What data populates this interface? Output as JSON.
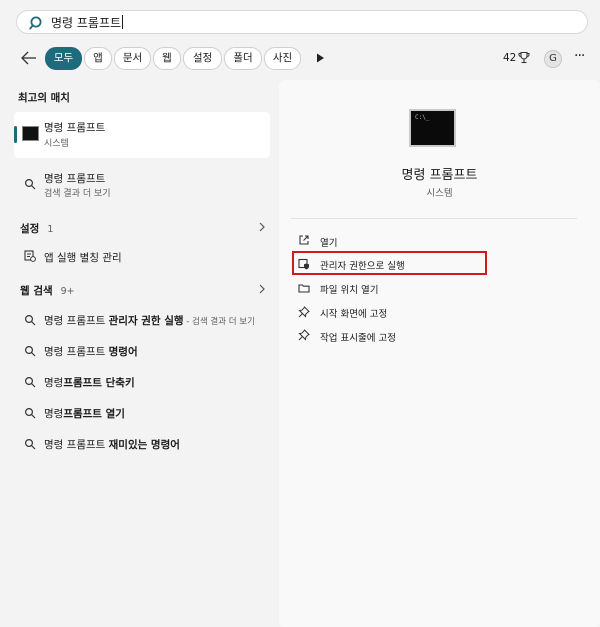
{
  "search": {
    "query": "명령 프롬프트"
  },
  "filters": {
    "items": [
      "모두",
      "앱",
      "문서",
      "웹",
      "설정",
      "폴더",
      "사진"
    ],
    "active_index": 0
  },
  "header_right": {
    "points": "42",
    "avatar_letter": "G",
    "more": "···"
  },
  "left": {
    "best_match_title": "최고의 매치",
    "best_match": {
      "name": "명령 프롬프트",
      "type": "시스템"
    },
    "search_item": {
      "name": "명령 프롬프트",
      "sub": "검색 결과 더 보기"
    },
    "settings": {
      "title": "설정",
      "count": "1",
      "item": "앱 실행 별칭 관리"
    },
    "web": {
      "title": "웹 검색",
      "count": "9+",
      "items": [
        {
          "prefix": "명령 프롬프트 ",
          "bold": "관리자 권한 실행",
          "suffix": " - 검색 결과 더 보기"
        },
        {
          "prefix": "명령 프롬프트 ",
          "bold": "명령어",
          "suffix": ""
        },
        {
          "prefix": "명령",
          "bold": "프롬프트 단축키",
          "suffix": ""
        },
        {
          "prefix": "명령",
          "bold": "프롬프트 열기",
          "suffix": ""
        },
        {
          "prefix": "명령 프롬프트 ",
          "bold": "재미있는 명령어",
          "suffix": ""
        }
      ]
    }
  },
  "right": {
    "app_name": "명령 프롬프트",
    "app_type": "시스템",
    "actions": [
      "열기",
      "관리자 권한으로 실행",
      "파일 위치 열기",
      "시작 화면에 고정",
      "작업 표시줄에 고정"
    ]
  },
  "colors": {
    "accent": "#1e6b7c",
    "highlight": "#d11a1a"
  },
  "icons": [
    "search-icon",
    "back-arrow-icon",
    "play-icon",
    "trophy-icon",
    "more-icon",
    "cmd-icon",
    "chevron-right-icon",
    "app-alias-icon",
    "open-icon",
    "shield-icon",
    "folder-icon",
    "pin-icon"
  ]
}
